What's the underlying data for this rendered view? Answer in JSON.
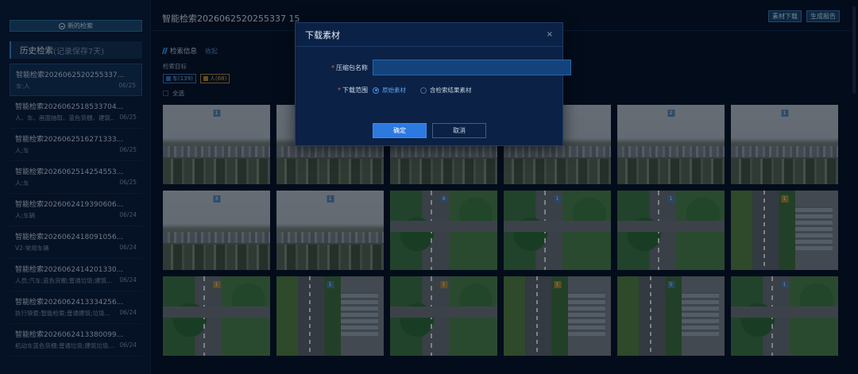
{
  "sidebar": {
    "new_search": "新的检索",
    "history_title": "历史检索",
    "history_sub": "(记录保存7天)",
    "items": [
      {
        "title": "智能检索2026062520255337...",
        "tags": "车;人",
        "date": "06/25"
      },
      {
        "title": "智能检索2026062518533704...",
        "tags": "人、车、画面抽取、蓝色货棚、建筑...",
        "date": "06/25"
      },
      {
        "title": "智能检索2026062516271333...",
        "tags": "人;车",
        "date": "06/25"
      },
      {
        "title": "智能检索2026062514254553...",
        "tags": "人;车",
        "date": "06/25"
      },
      {
        "title": "智能检索2026062419390606...",
        "tags": "人;车辆",
        "date": "06/24"
      },
      {
        "title": "智能检索2026062418091056...",
        "tags": "V2-常用车辆",
        "date": "06/24"
      },
      {
        "title": "智能检索2026062414201330...",
        "tags": "人员;汽车;蓝色货棚;普通垃圾;建筑...",
        "date": "06/24"
      },
      {
        "title": "智能检索2026062413334256...",
        "tags": "执行袋套;智能检索;普通建筑;垃圾...",
        "date": "06/24"
      },
      {
        "title": "智能检索2026062413380099...",
        "tags": "机动车蓝色货棚;普通垃圾;建筑垃圾...",
        "date": "06/24"
      }
    ]
  },
  "main": {
    "title": "智能检索2026062520255337 15",
    "buttons": {
      "download": "素材下载",
      "report": "生成报告"
    },
    "section_title": "检索信息",
    "collapse": "收起",
    "target_label": "检索目标",
    "chips": [
      {
        "label": "车(139)"
      },
      {
        "label": "人(68)"
      }
    ],
    "select_all": "全选"
  },
  "grid": {
    "rows": [
      [
        {
          "view": "v1",
          "badge": "1",
          "b": ""
        },
        {
          "view": "v1",
          "badge": "1",
          "b": ""
        },
        {
          "view": "v1",
          "badge": "1",
          "b": ""
        },
        {
          "view": "v1",
          "badge": "1",
          "b": ""
        },
        {
          "view": "v1",
          "badge": "2",
          "b": ""
        },
        {
          "view": "v1",
          "badge": "1",
          "b": ""
        }
      ],
      [
        {
          "view": "v1",
          "badge": "3",
          "b": ""
        },
        {
          "view": "v1",
          "badge": "1",
          "b": ""
        },
        {
          "view": "v2",
          "badge": "4",
          "b": ""
        },
        {
          "view": "v2",
          "badge": "1",
          "b": ""
        },
        {
          "view": "v2",
          "badge": "1",
          "b": ""
        },
        {
          "view": "v3",
          "badge": "1",
          "b": "o"
        }
      ],
      [
        {
          "view": "v2",
          "badge": "1",
          "b": "o"
        },
        {
          "view": "v3",
          "badge": "1",
          "b": ""
        },
        {
          "view": "v2",
          "badge": "1",
          "b": "o"
        },
        {
          "view": "v3",
          "badge": "1",
          "b": "o"
        },
        {
          "view": "v3",
          "badge": "5",
          "b": ""
        },
        {
          "view": "v2",
          "badge": "1",
          "b": ""
        }
      ]
    ]
  },
  "modal": {
    "title": "下载素材",
    "close": "×",
    "name_label": "压缩包名称",
    "name_value": "",
    "range_label": "下载范围",
    "options": [
      "原始素材",
      "含检索结果素材"
    ],
    "selected": "原始素材",
    "confirm": "确定",
    "cancel": "取消"
  }
}
